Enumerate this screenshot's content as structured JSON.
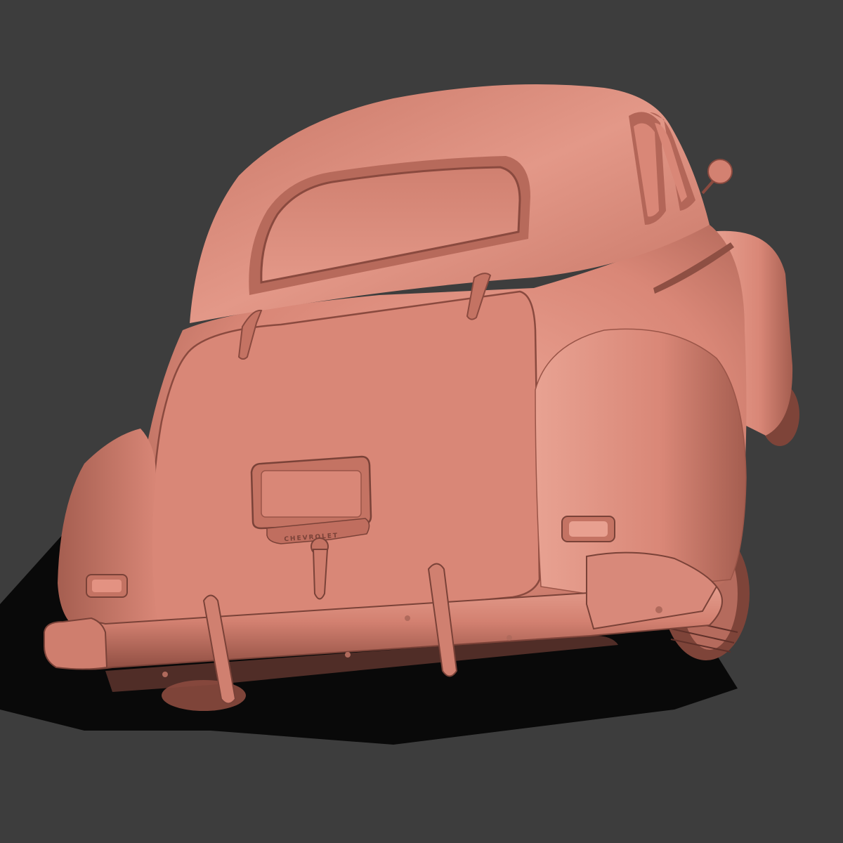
{
  "scene": {
    "subject": "car-render",
    "colors": {
      "background": "#3d3d3d",
      "shadow": "#000000",
      "body": "#d98777",
      "body_light": "#e9a090",
      "body_dark": "#9a5548",
      "crease": "#7a4238"
    }
  },
  "car": {
    "emblem_text": "CHEVROLET"
  }
}
